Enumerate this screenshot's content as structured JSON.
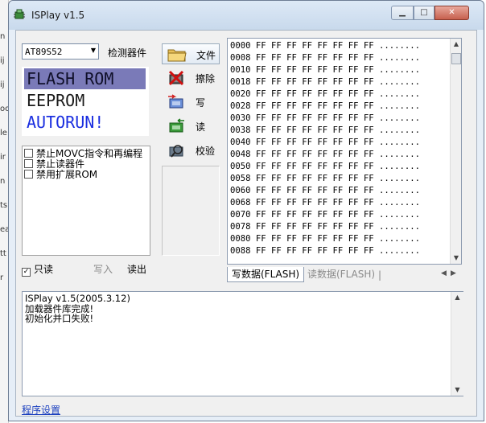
{
  "window": {
    "title": "ISPlay v1.5"
  },
  "background_window": {
    "chars": [
      "n",
      "ij",
      "ij",
      "oo",
      "le",
      "ir",
      "n",
      "ts",
      "ea",
      "tt",
      "r"
    ]
  },
  "device": {
    "selected": "AT89S52",
    "detect_label": "检测器件"
  },
  "memory_types": [
    "FLASH ROM",
    "EEPROM",
    "AUTORUN!"
  ],
  "options": [
    {
      "label": "禁止MOVC指令和再编程",
      "checked": false
    },
    {
      "label": "禁止读器件",
      "checked": false
    },
    {
      "label": "禁用扩展ROM",
      "checked": false
    }
  ],
  "readonly": {
    "label": "只读",
    "checked": true,
    "checkmark": "✓"
  },
  "bottom_actions": {
    "write_in": "写入",
    "read_out": "读出"
  },
  "actions": [
    {
      "label": "文件",
      "icon": "folder-icon"
    },
    {
      "label": "擦除",
      "icon": "erase-icon"
    },
    {
      "label": "写",
      "icon": "write-chip-icon"
    },
    {
      "label": "读",
      "icon": "read-chip-icon"
    },
    {
      "label": "校验",
      "icon": "verify-chip-icon"
    }
  ],
  "hex_lines": [
    "0000 FF FF FF FF FF FF FF FF ........",
    "0008 FF FF FF FF FF FF FF FF ........",
    "0010 FF FF FF FF FF FF FF FF ........",
    "0018 FF FF FF FF FF FF FF FF ........",
    "0020 FF FF FF FF FF FF FF FF ........",
    "0028 FF FF FF FF FF FF FF FF ........",
    "0030 FF FF FF FF FF FF FF FF ........",
    "0038 FF FF FF FF FF FF FF FF ........",
    "0040 FF FF FF FF FF FF FF FF ........",
    "0048 FF FF FF FF FF FF FF FF ........",
    "0050 FF FF FF FF FF FF FF FF ........",
    "0058 FF FF FF FF FF FF FF FF ........",
    "0060 FF FF FF FF FF FF FF FF ........",
    "0068 FF FF FF FF FF FF FF FF ........",
    "0070 FF FF FF FF FF FF FF FF ........",
    "0078 FF FF FF FF FF FF FF FF ........",
    "0080 FF FF FF FF FF FF FF FF ........",
    "0088 FF FF FF FF FF FF FF FF ........"
  ],
  "tabs": [
    "写数据(FLASH)",
    "读数据(FLASH)"
  ],
  "log": [
    "ISPlay v1.5(2005.3.12)",
    "加载器件库完成!",
    "初始化并口失败!"
  ],
  "settings_link": "程序设置",
  "colors": {
    "selected_memory_bg": "#7a7ab8",
    "autorun_text": "#1a2ee0",
    "link": "#1a3fbf"
  }
}
